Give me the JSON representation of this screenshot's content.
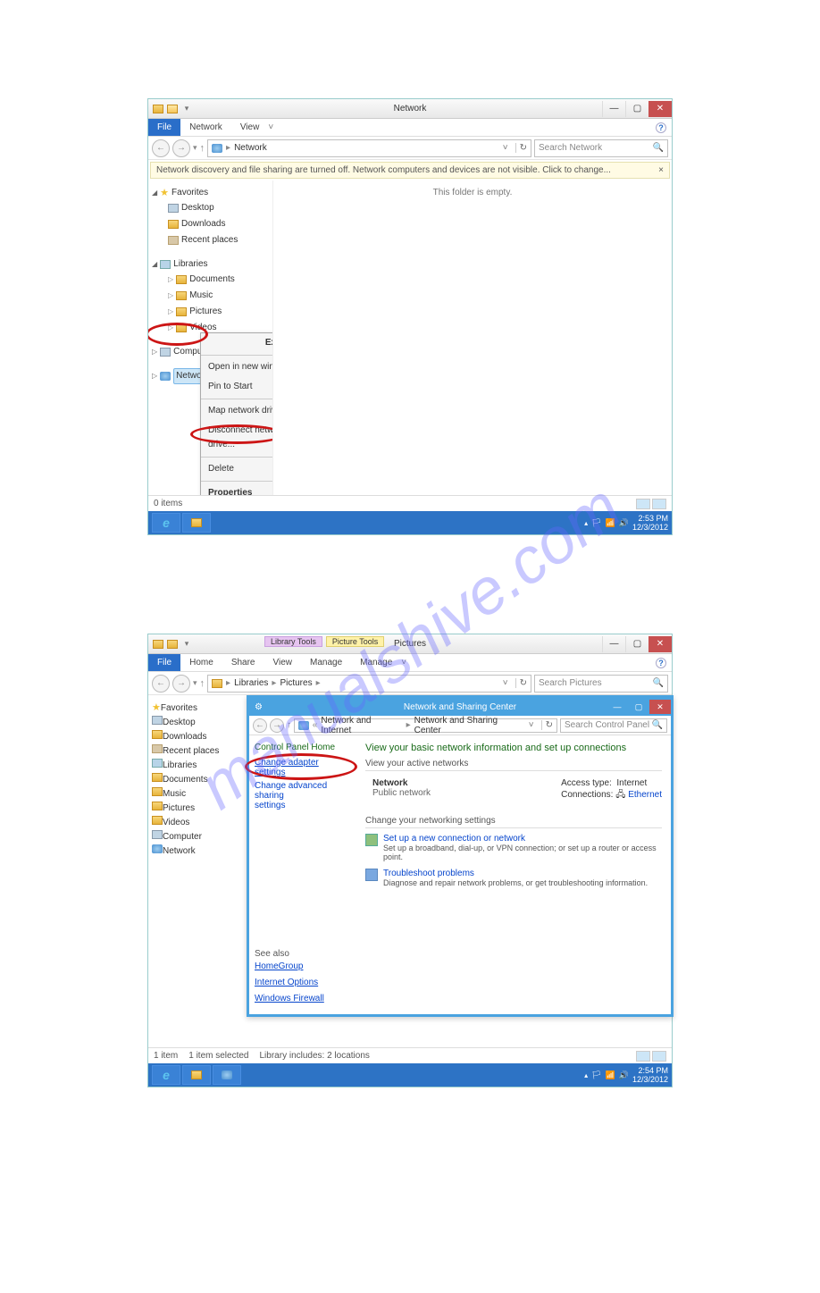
{
  "watermark": "manualshive.com",
  "screenshot1": {
    "title": "Network",
    "ribbon": {
      "file": "File",
      "tabs": [
        "Network",
        "View"
      ]
    },
    "addr": {
      "path": [
        "Network"
      ],
      "refresh_hint": "↻",
      "search_placeholder": "Search Network"
    },
    "warn": "Network discovery and file sharing are turned off. Network computers and devices are not visible. Click to change...",
    "warn_close": "×",
    "sidebar": {
      "favorites": {
        "label": "Favorites",
        "items": [
          "Desktop",
          "Downloads",
          "Recent places"
        ]
      },
      "libraries": {
        "label": "Libraries",
        "items": [
          "Documents",
          "Music",
          "Pictures",
          "Videos"
        ]
      },
      "computer": "Computer",
      "network": "Network"
    },
    "content_empty": "This folder is empty.",
    "context_menu": [
      "Expand",
      "Open in new window",
      "Pin to Start",
      "Map network drive...",
      "Disconnect network drive...",
      "Delete",
      "Properties"
    ],
    "status": "0 items",
    "taskbar": {
      "time": "2:53 PM",
      "date": "12/3/2012"
    }
  },
  "screenshot2": {
    "title": "Pictures",
    "tool_tabs": {
      "library": "Library Tools",
      "picture": "Picture Tools"
    },
    "ribbon": {
      "file": "File",
      "tabs": [
        "Home",
        "Share",
        "View",
        "Manage",
        "Manage"
      ]
    },
    "addr": {
      "path": [
        "Libraries",
        "Pictures"
      ],
      "search_placeholder": "Search Pictures"
    },
    "sidebar": {
      "favorites": {
        "label": "Favorites",
        "items": [
          "Desktop",
          "Downloads",
          "Recent places"
        ]
      },
      "libraries": {
        "label": "Libraries",
        "items": [
          "Documents",
          "Music",
          "Pictures",
          "Videos"
        ]
      },
      "computer": "Computer",
      "network": "Network"
    },
    "inner": {
      "title": "Network and Sharing Center",
      "addr": [
        "Network and Internet",
        "Network and Sharing Center"
      ],
      "search_placeholder": "Search Control Panel",
      "side": {
        "cph": "Control Panel Home",
        "link1": "Change adapter settings",
        "link2_a": "Change advanced sharing",
        "link2_b": "settings"
      },
      "main_heading": "View your basic network information and set up connections",
      "active_label": "View your active networks",
      "network_name": "Network",
      "network_type": "Public network",
      "access_label": "Access type:",
      "access_value": "Internet",
      "conn_label": "Connections:",
      "conn_value": "Ethernet",
      "change_label": "Change your networking settings",
      "act1_link": "Set up a new connection or network",
      "act1_desc": "Set up a broadband, dial-up, or VPN connection; or set up a router or access point.",
      "act2_link": "Troubleshoot problems",
      "act2_desc": "Diagnose and repair network problems, or get troubleshooting information.",
      "seealso": {
        "h": "See also",
        "links": [
          "HomeGroup",
          "Internet Options",
          "Windows Firewall"
        ]
      }
    },
    "status_left": "1 item",
    "status_mid": "1 item selected",
    "status_right": "Library includes: 2 locations",
    "taskbar": {
      "time": "2:54 PM",
      "date": "12/3/2012"
    }
  }
}
